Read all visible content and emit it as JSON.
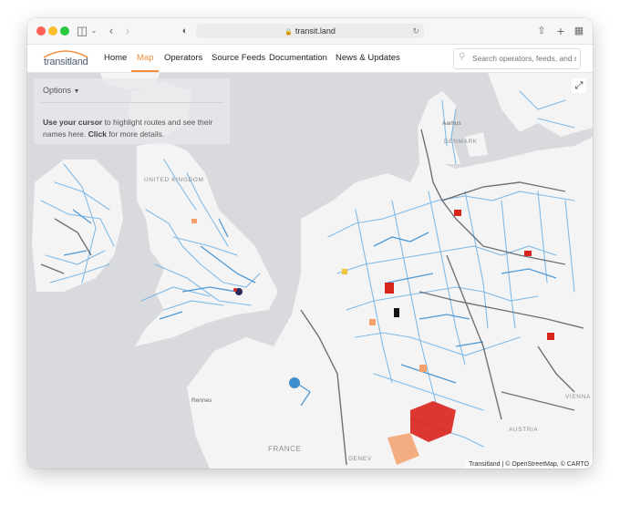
{
  "browser": {
    "url": "transit.land"
  },
  "nav": {
    "logo_text": "transitland",
    "items": [
      {
        "label": "Home"
      },
      {
        "label": "Map",
        "active": true
      },
      {
        "label": "Operators"
      },
      {
        "label": "Source Feeds"
      },
      {
        "label": "Documentation"
      },
      {
        "label": "News & Updates"
      }
    ],
    "search_placeholder": "Search operators, feeds, and r"
  },
  "panel": {
    "options_label": "Options",
    "help_bold1": "Use your cursor",
    "help_text1": " to highlight routes and see their names here. ",
    "help_bold2": "Click",
    "help_text2": " for more details."
  },
  "map_labels": {
    "denmark": "DENMARK",
    "united_kingdom": "UNITED KINGDOM",
    "france": "FRANCE",
    "austria": "AUSTRIA",
    "vienna": "VIENNA",
    "geneva": "GENEV",
    "aarhus": "Aarhus",
    "rennes": "Rennes"
  },
  "attribution": "Transitland | © OpenStreetMap, © CARTO",
  "colors": {
    "accent": "#f28d3c",
    "route_blue": "#3f8fd0",
    "route_dark": "#555a60",
    "hotspot_red": "#d9241c"
  }
}
